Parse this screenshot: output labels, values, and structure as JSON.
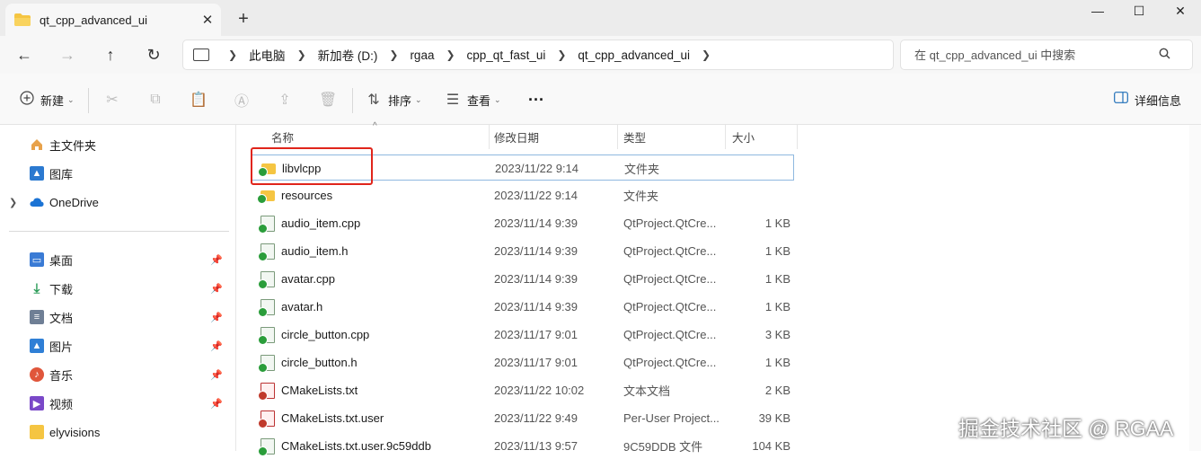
{
  "window": {
    "tab_title": "qt_cpp_advanced_ui",
    "new_tab": "+",
    "close_tab": "✕",
    "minimize": "—",
    "maximize": "☐",
    "close": "✕"
  },
  "nav": {
    "back": "←",
    "forward": "→",
    "up": "↑",
    "refresh": "↻",
    "breadcrumbs": [
      "此电脑",
      "新加卷 (D:)",
      "rgaa",
      "cpp_qt_fast_ui",
      "qt_cpp_advanced_ui"
    ],
    "search_placeholder": "在 qt_cpp_advanced_ui 中搜索"
  },
  "toolbar": {
    "new_label": "新建",
    "sort_label": "排序",
    "view_label": "查看",
    "more": "···",
    "details_label": "详细信息"
  },
  "sidebar": {
    "top": [
      {
        "label": "主文件夹",
        "icon": "home-icon"
      },
      {
        "label": "图库",
        "icon": "gallery-icon"
      },
      {
        "label": "OneDrive",
        "icon": "cloud-icon"
      }
    ],
    "pinned": [
      {
        "label": "桌面",
        "icon": "desktop-icon",
        "color": "#3a7bd5"
      },
      {
        "label": "下载",
        "icon": "download-icon",
        "color": "#2e9d5a"
      },
      {
        "label": "文档",
        "icon": "document-icon",
        "color": "#6f7f95"
      },
      {
        "label": "图片",
        "icon": "picture-icon",
        "color": "#2f7fd6"
      },
      {
        "label": "音乐",
        "icon": "music-icon",
        "color": "#e0563b"
      },
      {
        "label": "视频",
        "icon": "video-icon",
        "color": "#7a48c8"
      },
      {
        "label": "elyvisions",
        "icon": "folder-icon",
        "color": "#f5c542"
      }
    ]
  },
  "columns": {
    "name": "名称",
    "date": "修改日期",
    "type": "类型",
    "size": "大小"
  },
  "files": [
    {
      "name": "libvlcpp",
      "date": "2023/11/22 9:14",
      "type": "文件夹",
      "size": "",
      "kind": "folder"
    },
    {
      "name": "resources",
      "date": "2023/11/22 9:14",
      "type": "文件夹",
      "size": "",
      "kind": "folder"
    },
    {
      "name": "audio_item.cpp",
      "date": "2023/11/14 9:39",
      "type": "QtProject.QtCre...",
      "size": "1 KB",
      "kind": "cpp"
    },
    {
      "name": "audio_item.h",
      "date": "2023/11/14 9:39",
      "type": "QtProject.QtCre...",
      "size": "1 KB",
      "kind": "cpp"
    },
    {
      "name": "avatar.cpp",
      "date": "2023/11/14 9:39",
      "type": "QtProject.QtCre...",
      "size": "1 KB",
      "kind": "cpp"
    },
    {
      "name": "avatar.h",
      "date": "2023/11/14 9:39",
      "type": "QtProject.QtCre...",
      "size": "1 KB",
      "kind": "cpp"
    },
    {
      "name": "circle_button.cpp",
      "date": "2023/11/17 9:01",
      "type": "QtProject.QtCre...",
      "size": "3 KB",
      "kind": "cpp"
    },
    {
      "name": "circle_button.h",
      "date": "2023/11/17 9:01",
      "type": "QtProject.QtCre...",
      "size": "1 KB",
      "kind": "cpp"
    },
    {
      "name": "CMakeLists.txt",
      "date": "2023/11/22 10:02",
      "type": "文本文档",
      "size": "2 KB",
      "kind": "txt"
    },
    {
      "name": "CMakeLists.txt.user",
      "date": "2023/11/22 9:49",
      "type": "Per-User Project...",
      "size": "39 KB",
      "kind": "txt"
    },
    {
      "name": "CMakeLists.txt.user.9c59ddb",
      "date": "2023/11/13 9:57",
      "type": "9C59DDB 文件",
      "size": "104 KB",
      "kind": "cpp"
    }
  ],
  "watermark": "掘金技术社区 @ RGAA"
}
